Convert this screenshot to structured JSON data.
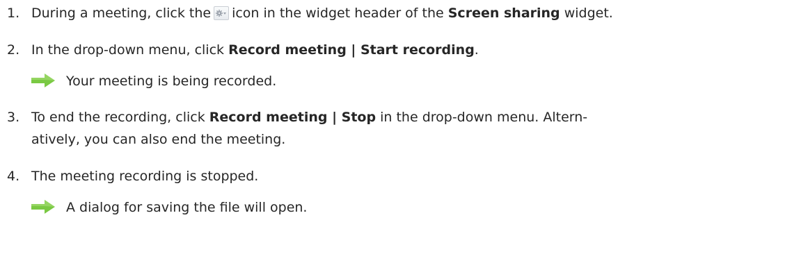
{
  "steps": [
    {
      "number": "1.",
      "text_before": "During a meeting, click the",
      "icon": "gear-dropdown-icon",
      "text_middle": "icon in the widget header of the",
      "bold": "Screen sharing",
      "text_after": "widget."
    },
    {
      "number": "2.",
      "text_before": "In the drop-down menu, click",
      "bold": "Record meeting | Start recording",
      "text_after": ".",
      "result": "Your meeting is being recorded."
    },
    {
      "number": "3.",
      "text_before": "To end the recording, click",
      "bold": "Record meeting | Stop",
      "text_after": "in the drop-down menu. Altern-",
      "line2": "atively, you can also end the meeting."
    },
    {
      "number": "4.",
      "text": "The meeting recording is stopped.",
      "result": "A dialog for saving the file will open."
    }
  ],
  "colors": {
    "text": "#262626",
    "arrow": "#7ac943",
    "icon_border": "#c9cdd3"
  }
}
